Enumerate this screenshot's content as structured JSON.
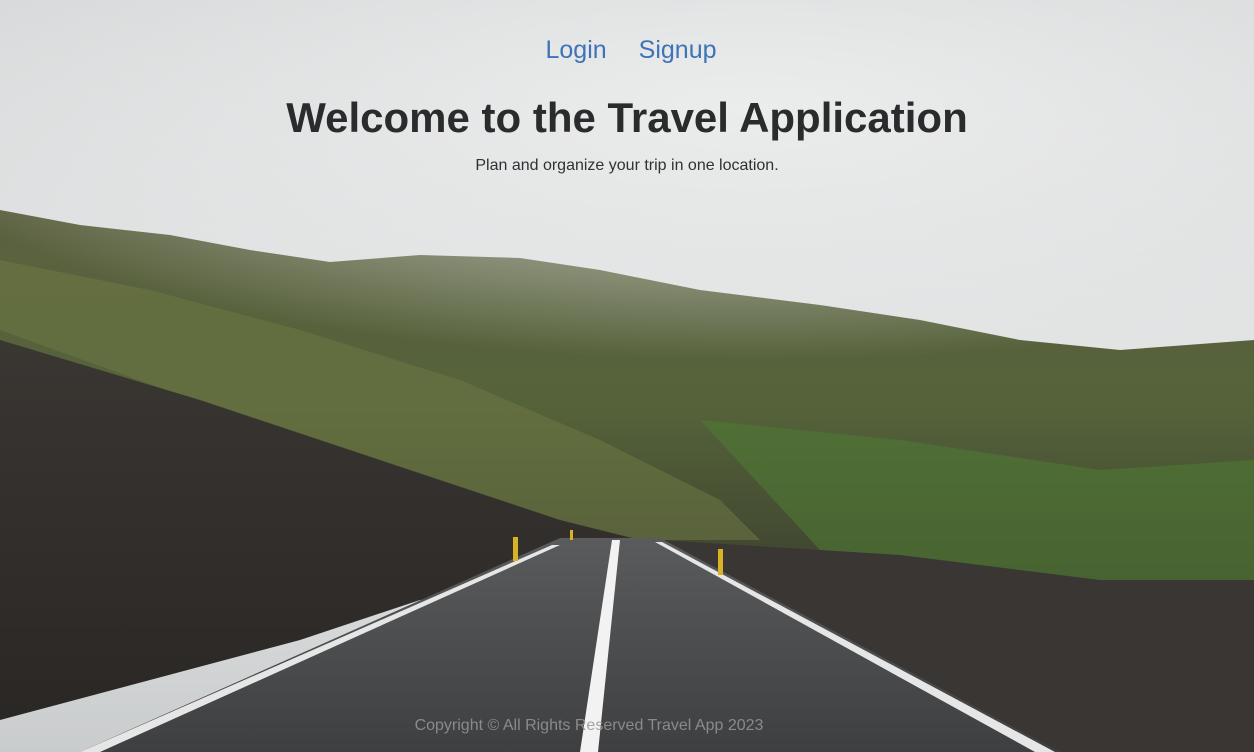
{
  "nav": {
    "login_label": "Login",
    "signup_label": "Signup"
  },
  "hero": {
    "title": "Welcome to the Travel Application",
    "subtitle": "Plan and organize your trip in one location."
  },
  "footer": {
    "copyright": "Copyright © All Rights Reserved Travel App 2023"
  },
  "colors": {
    "link": "#3d73b8",
    "title": "#2a2b2c",
    "footer_text": "#969696"
  },
  "background": {
    "scene": "foggy-mountain-road"
  }
}
